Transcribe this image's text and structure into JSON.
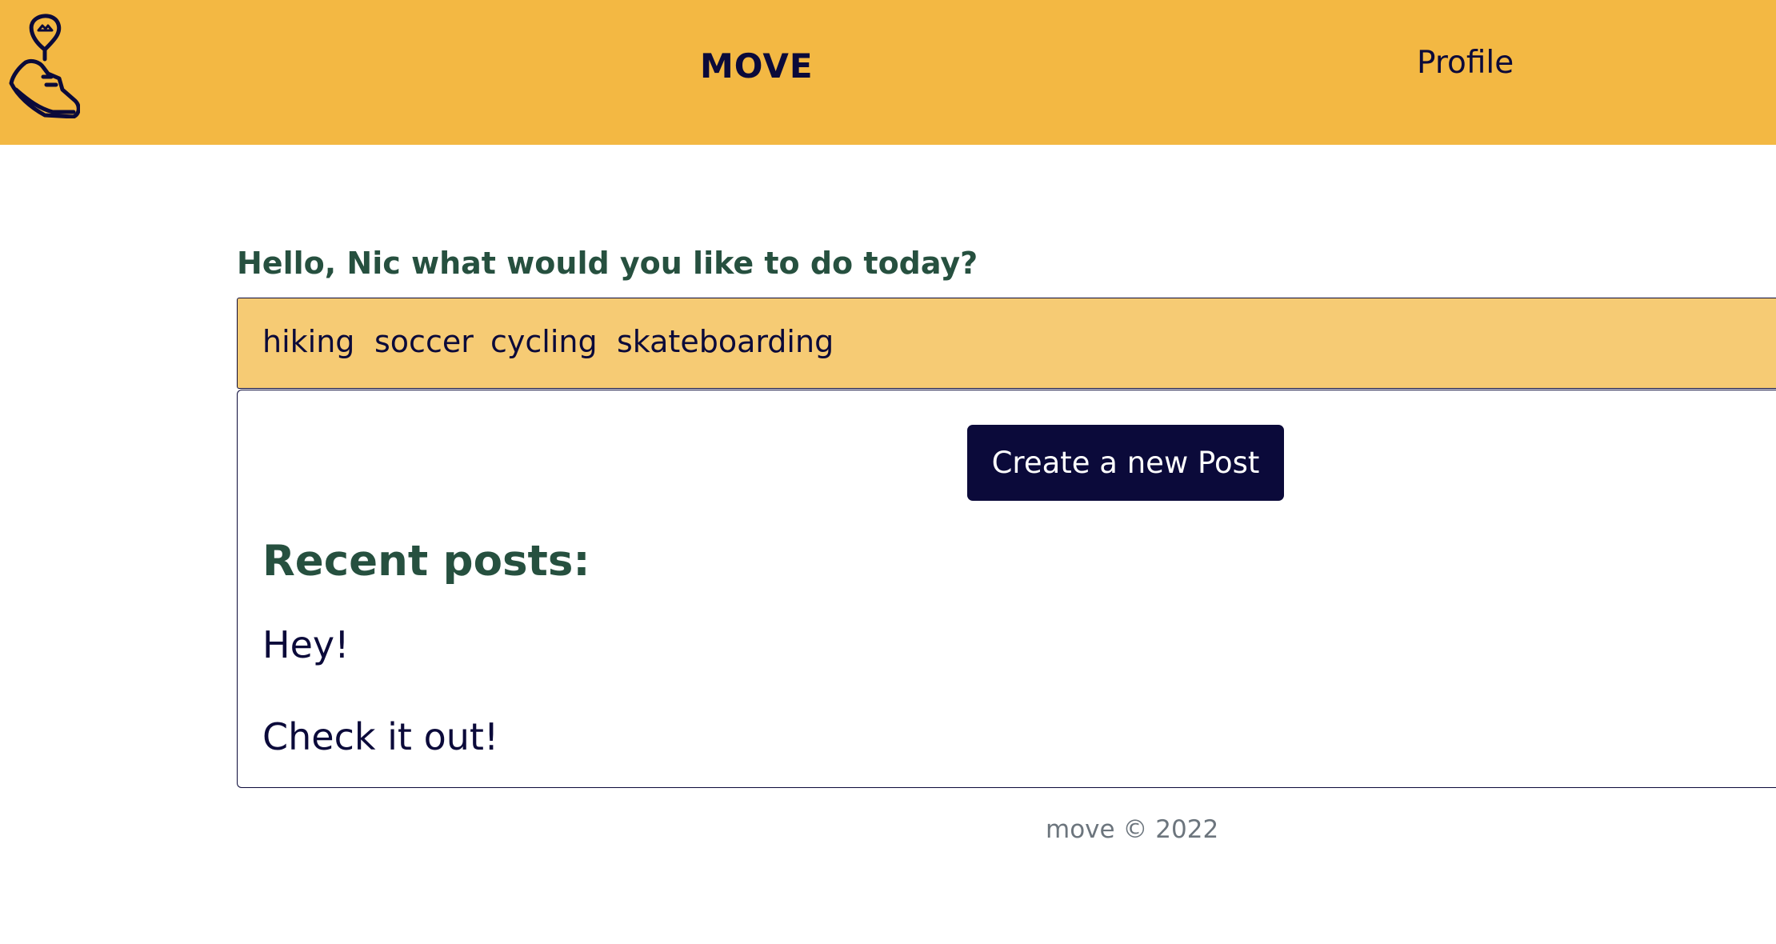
{
  "header": {
    "brand": "MOVE",
    "nav": {
      "profile": "Profile"
    }
  },
  "main": {
    "greeting": "Hello, Nic what would you like to do today?",
    "activities": [
      "hiking",
      "soccer",
      "cycling",
      "skateboarding"
    ],
    "create_button": "Create a new Post",
    "recent_title": "Recent posts:",
    "posts": [
      "Hey!",
      "Check it out!"
    ]
  },
  "footer": {
    "text": "move © 2022"
  },
  "colors": {
    "navbar": "#f3b843",
    "tags_bar": "#f6cb74",
    "primary": "#0b0a3a",
    "heading_green": "#26503f",
    "footer_text": "#6c757d"
  },
  "icons": {
    "logo": "running-shoe-location-pin-icon"
  }
}
